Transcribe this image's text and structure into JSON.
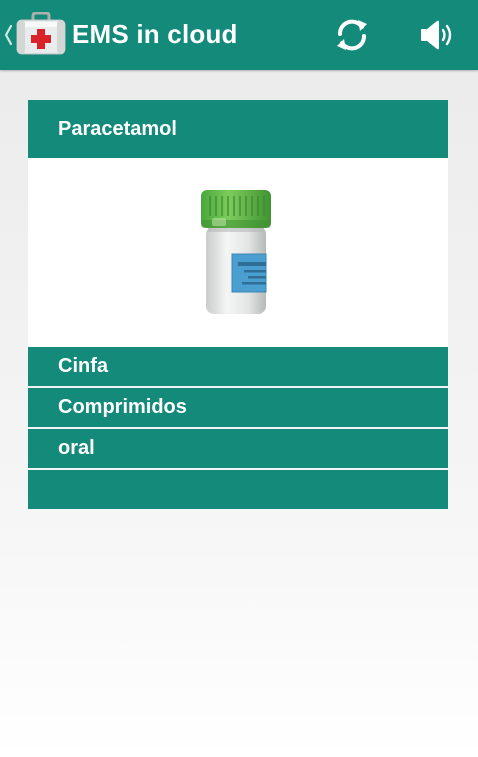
{
  "app_bar": {
    "title": "EMS in cloud",
    "background": "#138a7a",
    "up_icon": "chevron-left-icon",
    "app_icon": "first-aid-kit-icon",
    "actions": [
      {
        "icon": "refresh-icon"
      },
      {
        "icon": "volume-icon"
      }
    ]
  },
  "medication": {
    "name": "Paracetamol",
    "image_icon": "pill-bottle-icon",
    "details": [
      {
        "label": "Cinfa"
      },
      {
        "label": "Comprimidos"
      },
      {
        "label": "oral"
      },
      {
        "label": ""
      }
    ]
  },
  "colors": {
    "accent": "#138a7a",
    "bottle_cap": "#5cb848",
    "bottle_label": "#4a9fd0"
  }
}
